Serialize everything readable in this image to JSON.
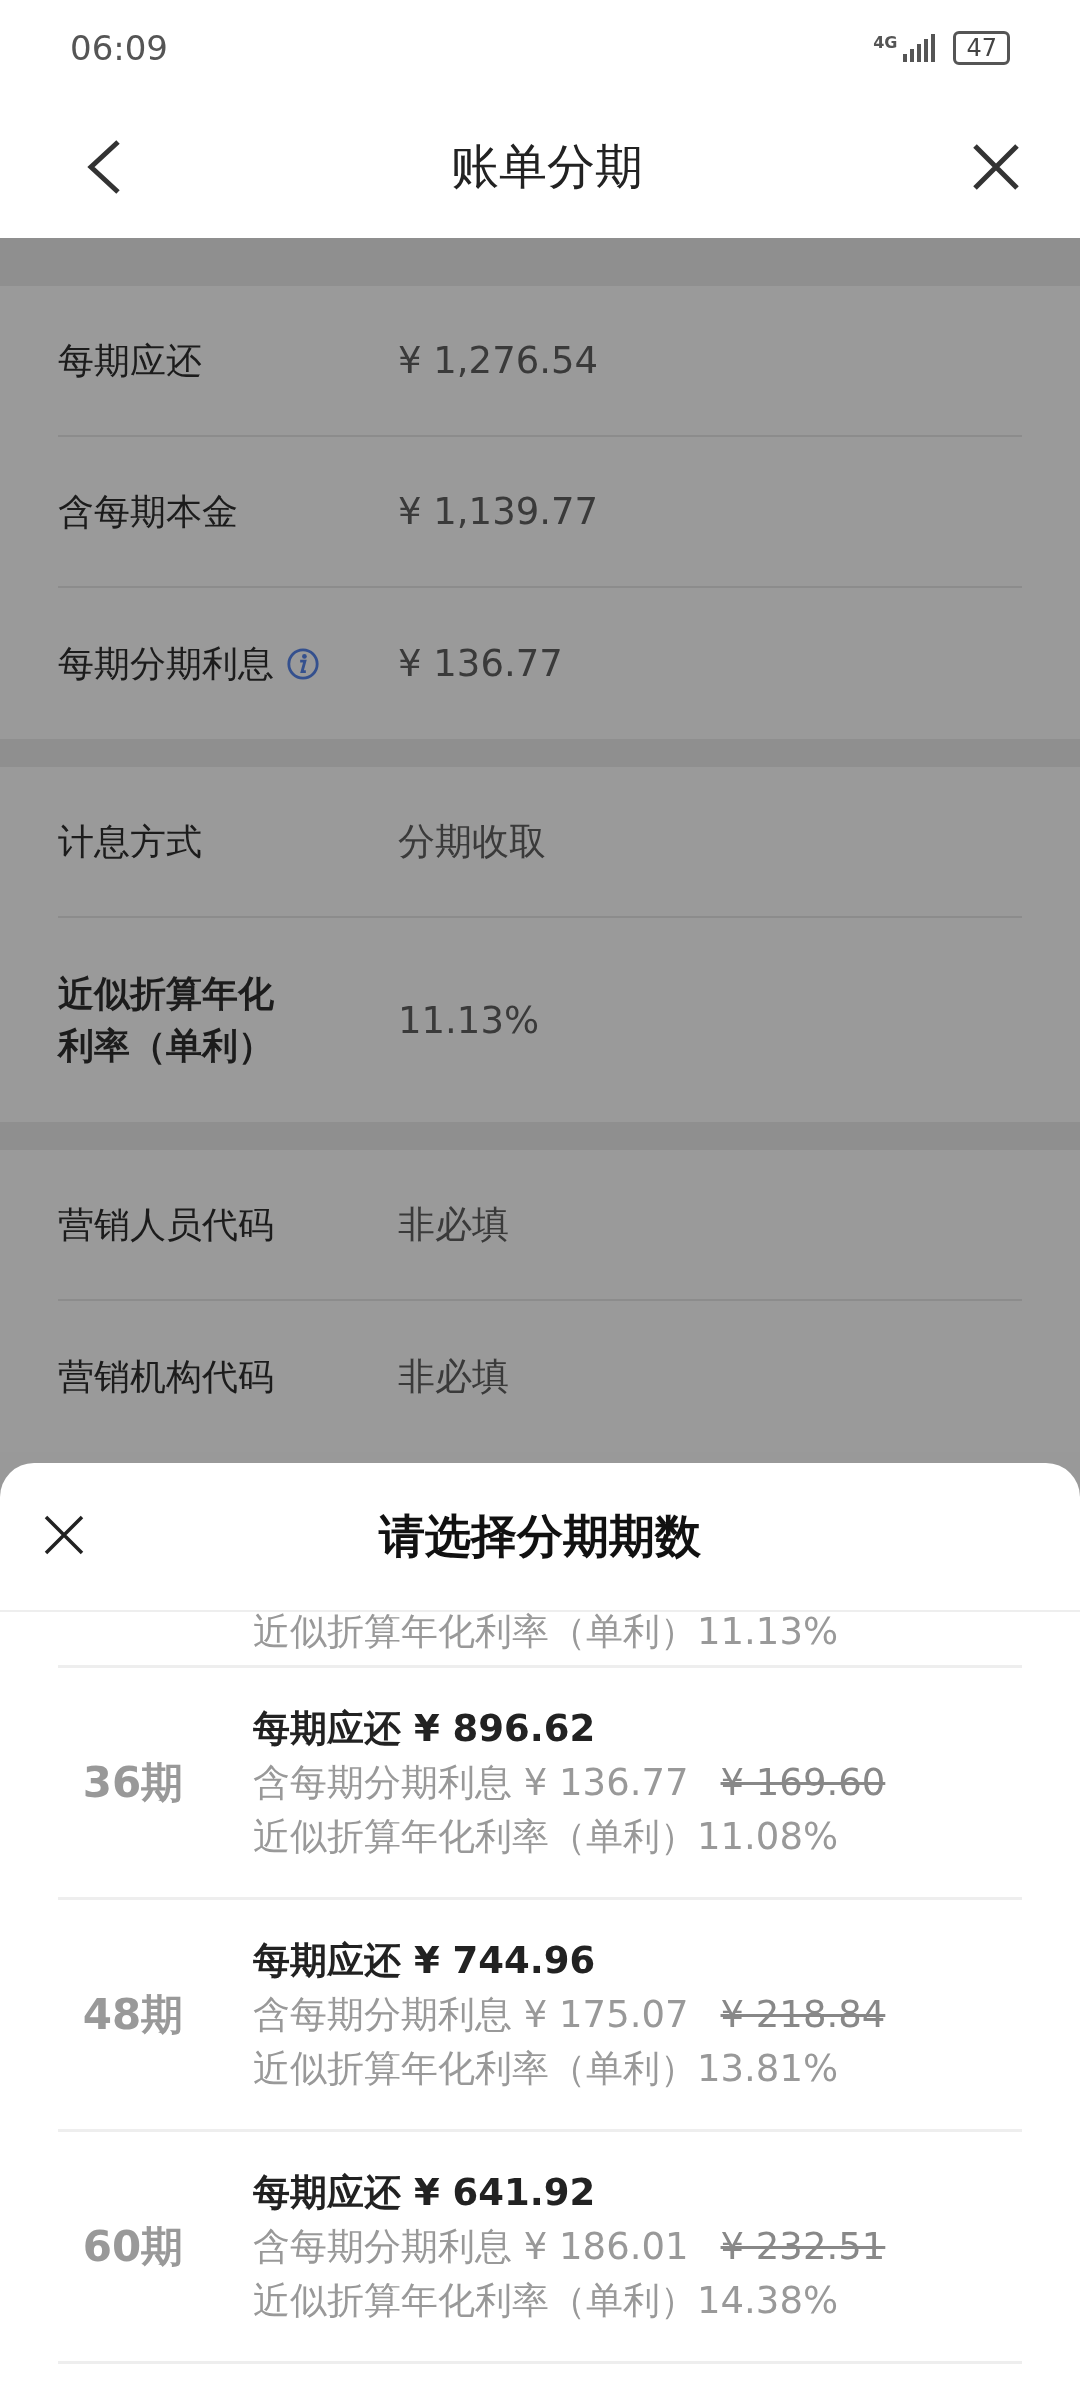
{
  "status_bar": {
    "time": "06:09",
    "network": "4G",
    "battery": "47"
  },
  "header": {
    "title": "账单分期"
  },
  "sections": [
    {
      "rows": [
        {
          "label": "每期应还",
          "value": "¥ 1,276.54",
          "info": false,
          "bold": false
        },
        {
          "label": "含每期本金",
          "value": "¥ 1,139.77",
          "info": false,
          "bold": false
        },
        {
          "label": "每期分期利息",
          "value": "¥ 136.77",
          "info": true,
          "bold": false
        }
      ]
    },
    {
      "rows": [
        {
          "label": "计息方式",
          "value": "分期收取",
          "info": false,
          "bold": false
        },
        {
          "label": "近似折算年化利率（单利）",
          "value": "11.13%",
          "info": false,
          "bold": true
        }
      ]
    },
    {
      "rows": [
        {
          "label": "营销人员代码",
          "value": "非必填",
          "info": false,
          "bold": false
        },
        {
          "label": "营销机构代码",
          "value": "非必填",
          "info": false,
          "bold": false
        }
      ]
    }
  ],
  "sheet": {
    "title": "请选择分期期数",
    "options": [
      {
        "kind": "partial",
        "rate": "近似折算年化利率（单利）11.13%"
      },
      {
        "kind": "full",
        "term": "36期",
        "payment": "每期应还 ¥ 896.62",
        "interest": "含每期分期利息 ¥ 136.77",
        "original_interest": "¥ 169.60",
        "rate": "近似折算年化利率（单利）11.08%"
      },
      {
        "kind": "full",
        "term": "48期",
        "payment": "每期应还 ¥ 744.96",
        "interest": "含每期分期利息 ¥ 175.07",
        "original_interest": "¥ 218.84",
        "rate": "近似折算年化利率（单利）13.81%"
      },
      {
        "kind": "full",
        "term": "60期",
        "payment": "每期应还 ¥ 641.92",
        "interest": "含每期分期利息 ¥ 186.01",
        "original_interest": "¥ 232.51",
        "rate": "近似折算年化利率（单利）14.38%"
      }
    ]
  }
}
